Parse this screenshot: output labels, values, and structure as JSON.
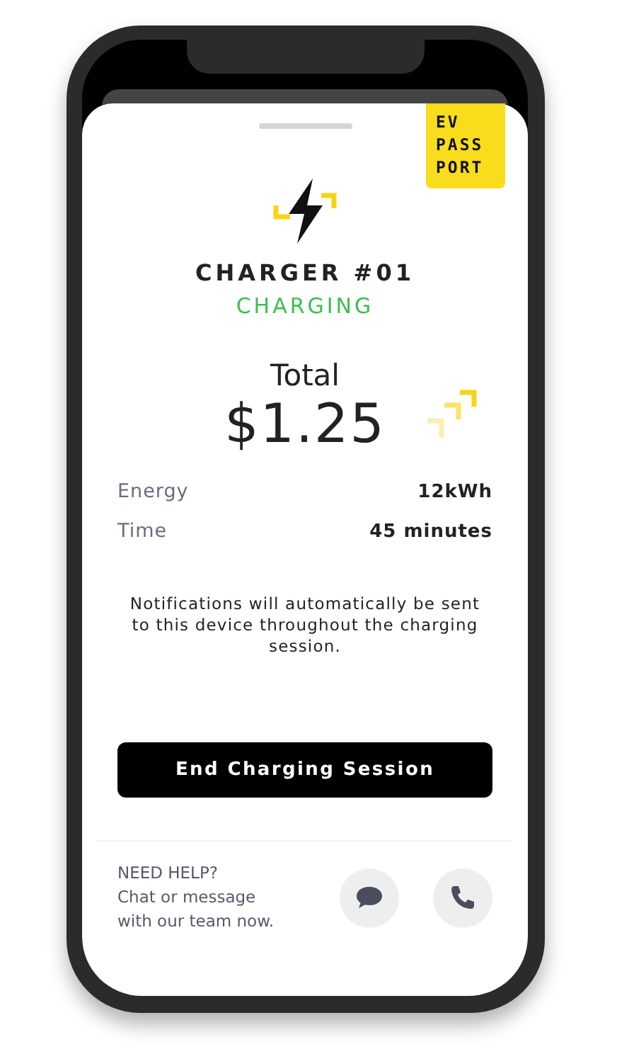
{
  "logo": {
    "lines": [
      "EV",
      "PASS",
      "PORT"
    ]
  },
  "charger": {
    "name": "CHARGER #01",
    "status": "CHARGING",
    "active": true
  },
  "total": {
    "label": "Total",
    "amount": "$1.25"
  },
  "details": [
    {
      "label": "Energy",
      "value": "12kWh"
    },
    {
      "label": "Time",
      "value": "45 minutes"
    }
  ],
  "notice": "Notifications will automatically be sent to this device throughout the charging session.",
  "end_button": "End Charging Session",
  "help": {
    "title": "NEED HELP?",
    "lines": [
      "Chat or message",
      "with our team now."
    ]
  },
  "help_actions": [
    {
      "kind": "chat"
    },
    {
      "kind": "call"
    }
  ]
}
